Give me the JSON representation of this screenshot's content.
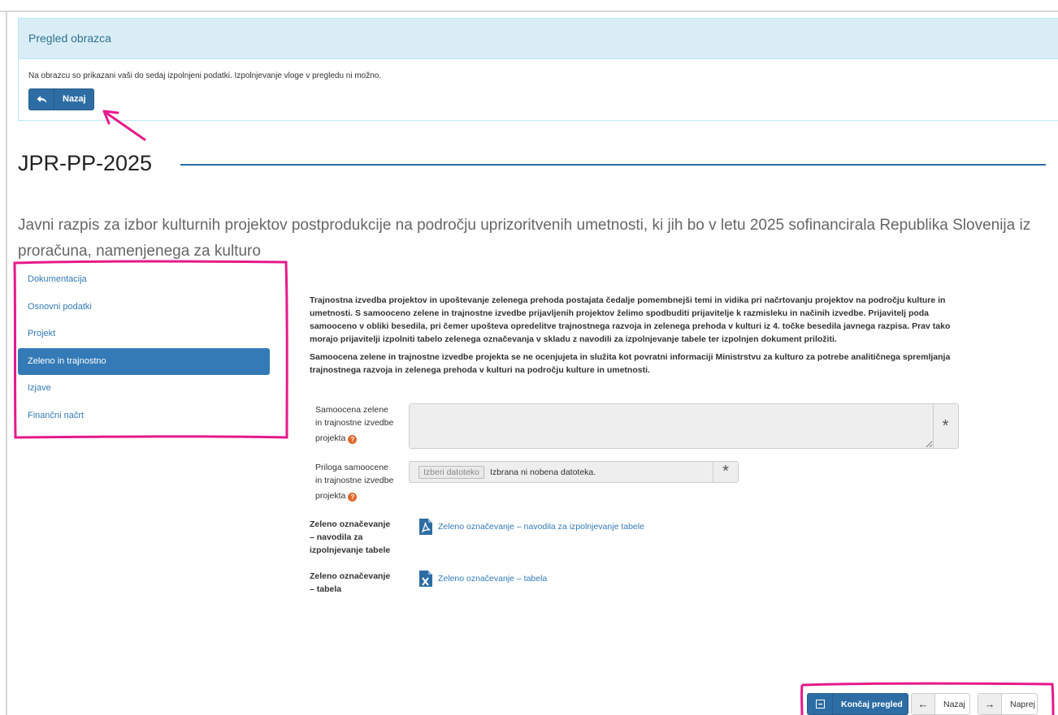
{
  "preview": {
    "heading": "Pregled obrazca",
    "info": "Na obrazcu so prikazani vaši do sedaj izpolnjeni podatki. Izpolnjevanje vloge v pregledu ni možno.",
    "back_label": "Nazaj"
  },
  "form": {
    "code": "JPR-PP-2025",
    "title": "Javni razpis za izbor kulturnih projektov postprodukcije na področju uprizoritvenih umetnosti, ki jih bo v letu 2025 sofinancirala Republika Slovenija iz proračuna, namenjenega za kulturo"
  },
  "sidebar": {
    "items": [
      {
        "label": "Dokumentacija",
        "active": false
      },
      {
        "label": "Osnovni podatki",
        "active": false
      },
      {
        "label": "Projekt",
        "active": false
      },
      {
        "label": "Zeleno in trajnostno",
        "active": true
      },
      {
        "label": "Izjave",
        "active": false
      },
      {
        "label": "Finančni načrt",
        "active": false
      }
    ]
  },
  "content": {
    "paragraph1": "Trajnostna izvedba projektov in upoštevanje zelenega prehoda postajata čedalje pomembnejši temi in vidika pri načrtovanju projektov na področju kulture in umetnosti. S samooceno zelene in trajnostne izvedbe prijavljenih projektov želimo spodbuditi prijavitelje k razmisleku in načinih izvedbe. Prijavitelj poda samooceno v obliki besedila, pri čemer upošteva opredelitve trajnostnega razvoja in zelenega prehoda v kulturi iz 4. točke besedila javnega razpisa. Prav tako morajo prijavitelji izpolniti tabelo zelenega označevanja v skladu z navodili za izpolnjevanje tabele ter izpolnjen dokument priložiti.",
    "paragraph2": "Samoocena zelene in trajnostne izvedbe projekta se ne ocenjujeta in služita kot povratni informaciji Ministrstvu za kulturo za potrebe analitičnega spremljanja trajnostnega razvoja in zelenega prehoda v kulturi na področju kulture in umetnosti.",
    "self_assessment": {
      "label_line1": "Samoocena zelene",
      "label_line2": "in trajnostne izvedbe",
      "label_line3": "projekta",
      "value": "",
      "required_mark": "*"
    },
    "attachment": {
      "label_line1": "Priloga samoocene",
      "label_line2": "in trajnostne izvedbe",
      "label_line3": "projekta",
      "button": "Izberi datoteko",
      "status": "Izbrana ni nobena datoteka.",
      "required_mark": "*"
    },
    "instructions": {
      "label_line1": "Zeleno označevanje",
      "label_line2": "– navodila za",
      "label_line3": "izpolnjevanje tabele",
      "link": "Zeleno označevanje – navodila za izpolnjevanje tabele",
      "icon": "pdf-file-icon"
    },
    "table": {
      "label_line1": "Zeleno označevanje",
      "label_line2": "– tabela",
      "link": "Zeleno označevanje – tabela",
      "icon": "excel-file-icon"
    }
  },
  "footer": {
    "finish_label": "Končaj pregled",
    "prev_label": "Nazaj",
    "next_label": "Naprej"
  },
  "colors": {
    "primary": "#337ab7",
    "annotation": "#e5198a",
    "info_bg": "#d9edf7"
  }
}
